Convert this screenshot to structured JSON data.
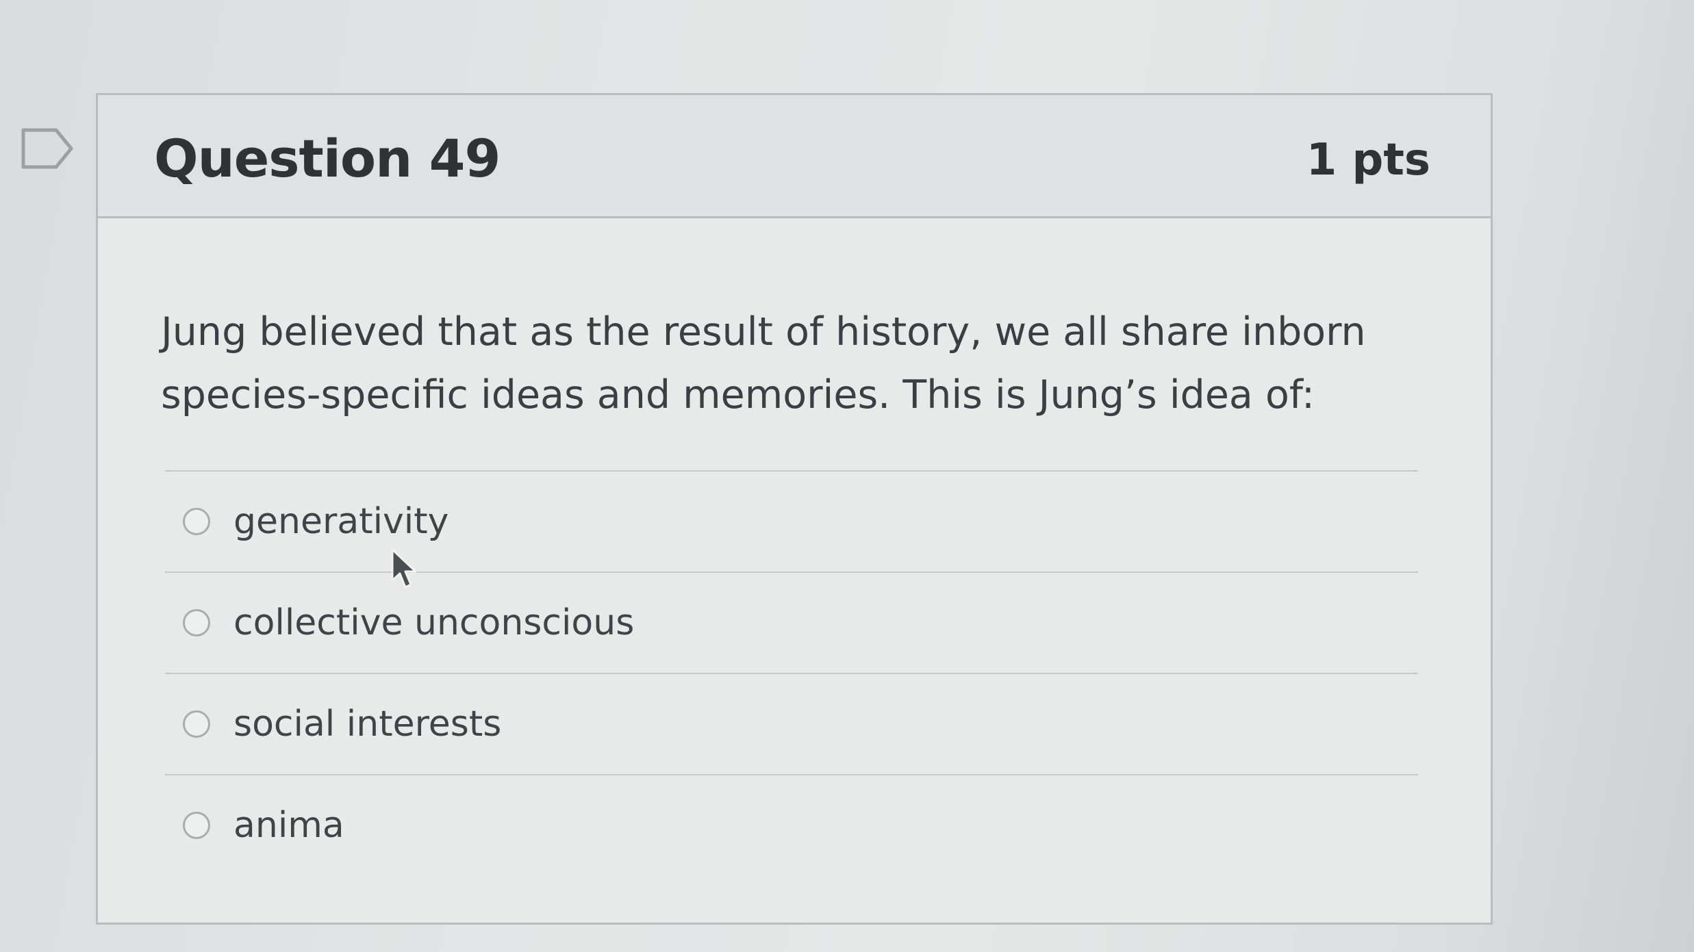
{
  "question": {
    "title": "Question 49",
    "points": "1 pts",
    "text": "Jung believed that as the result of history, we all share inborn species-specific ideas and memories. This is Jung’s idea of:",
    "answers": [
      {
        "label": "generativity",
        "selected": false
      },
      {
        "label": "collective unconscious",
        "selected": false
      },
      {
        "label": "social interests",
        "selected": false
      },
      {
        "label": "anima",
        "selected": false
      }
    ]
  },
  "icons": {
    "flag": "flag-question-icon",
    "cursor": "mouse-pointer-icon"
  },
  "colors": {
    "background": "#e3e6e6",
    "border": "#b9bdbf",
    "text": "#3a3e42"
  }
}
